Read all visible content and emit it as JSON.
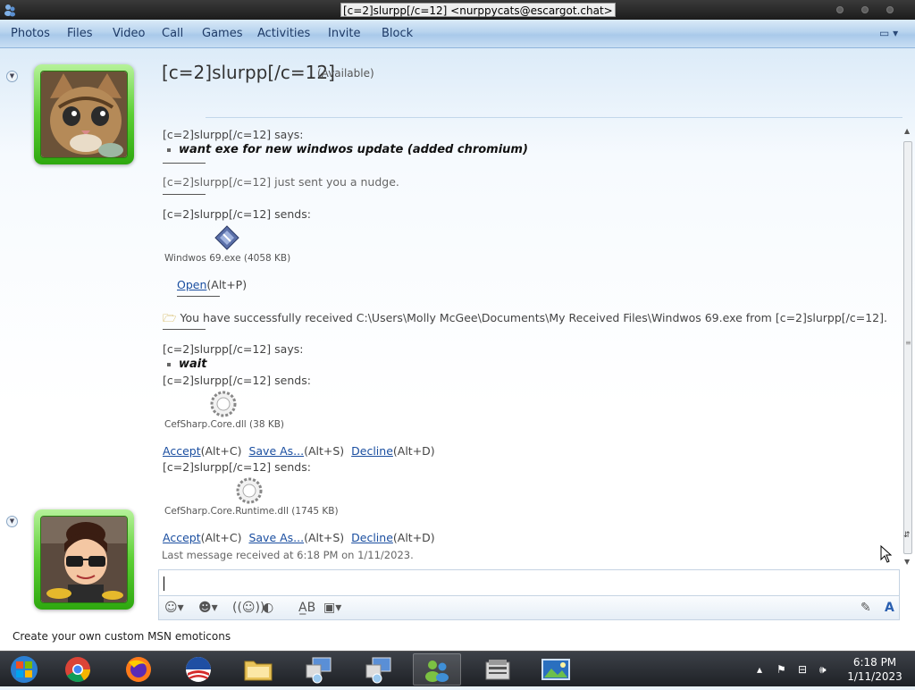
{
  "window": {
    "title": "[c=2]slurpp[/c=12] <nurppycats@escargot.chat>"
  },
  "menu": [
    "Photos",
    "Files",
    "Video",
    "Call",
    "Games",
    "Activities",
    "Invite",
    "Block"
  ],
  "contact": {
    "name": "[c=2]slurpp[/c=12]",
    "status": "(Available)"
  },
  "conversation": {
    "says1": "[c=2]slurpp[/c=12] says:",
    "msg1": "want exe for new windwos update (added chromium)",
    "nudge": "[c=2]slurpp[/c=12] just sent you a nudge.",
    "sends1": "[c=2]slurpp[/c=12] sends:",
    "file1": "Windwos 69.exe (4058 KB)",
    "open_label": "Open",
    "open_shortcut": "(Alt+P)",
    "received": "You have successfully received C:\\Users\\Molly McGee\\Documents\\My Received Files\\Windwos 69.exe from [c=2]slurpp[/c=12].",
    "says2": "[c=2]slurpp[/c=12] says:",
    "msg2": "wait",
    "sends2": "[c=2]slurpp[/c=12] sends:",
    "file2": "CefSharp.Core.dll (38 KB)",
    "sends3": "[c=2]slurpp[/c=12] sends:",
    "file3": "CefSharp.Core.Runtime.dll (1745 KB)",
    "accept_label": "Accept",
    "accept_shortcut": "(Alt+C)",
    "saveas_label": "Save As...",
    "saveas_shortcut": "(Alt+S)",
    "decline_label": "Decline",
    "decline_shortcut": "(Alt+D)"
  },
  "last_message": "Last message received at 6:18 PM on 1/11/2023.",
  "footer_link": "Create your own custom MSN emoticons",
  "taskbar": {
    "time": "6:18 PM",
    "date": "1/11/2023"
  },
  "colors": {
    "link": "#1a4ea0",
    "avatar_frame": "#5ccf34",
    "menu_text": "#1e3a66"
  }
}
